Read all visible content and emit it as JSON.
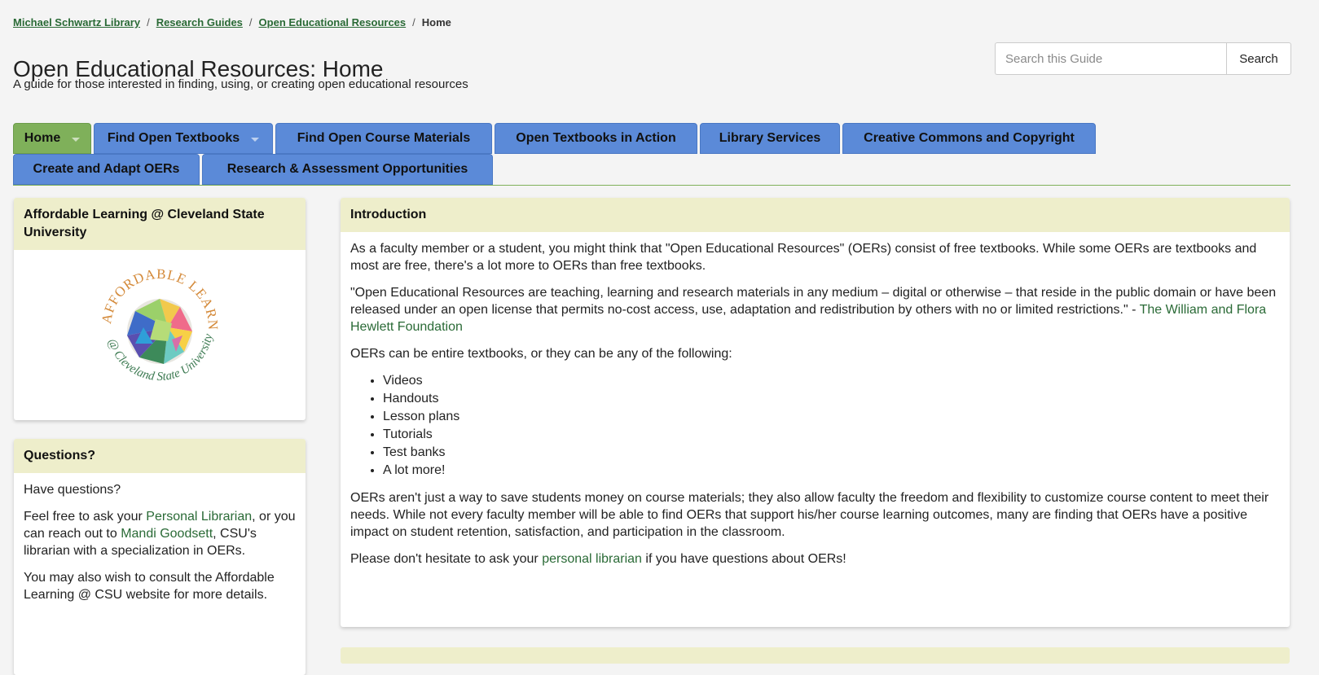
{
  "breadcrumb": {
    "items": [
      "Michael Schwartz Library",
      "Research Guides",
      "Open Educational Resources"
    ],
    "current": "Home",
    "separator": "/"
  },
  "header": {
    "title": "Open Educational Resources: Home",
    "subtitle": "A guide for those interested in finding, using, or creating open educational resources"
  },
  "search": {
    "placeholder": "Search this Guide",
    "button_label": "Search"
  },
  "tabs": {
    "row1": [
      {
        "label": "Home",
        "active": true,
        "dropdown": true
      },
      {
        "label": "Find Open Textbooks",
        "active": false,
        "dropdown": true
      },
      {
        "label": "Find Open Course Materials",
        "active": false,
        "dropdown": false
      },
      {
        "label": "Open Textbooks in Action",
        "active": false,
        "dropdown": false
      },
      {
        "label": "Library Services",
        "active": false,
        "dropdown": false
      },
      {
        "label": "Creative Commons and Copyright",
        "active": false,
        "dropdown": false
      }
    ],
    "row2": [
      {
        "label": "Create and Adapt OERs",
        "active": false,
        "dropdown": false
      },
      {
        "label": "Research & Assessment Opportunities",
        "active": false,
        "dropdown": false
      }
    ]
  },
  "sidebar": {
    "affordable": {
      "title": "Affordable Learning @ Cleveland State University",
      "logo_text_top": "AFFORDABLE LEARNING",
      "logo_text_bottom": "@ Cleveland State University"
    },
    "questions": {
      "title": "Questions?",
      "p1": "Have questions?",
      "p2_a": "Feel free to ask your ",
      "p2_link1": "Personal Librarian",
      "p2_b": ", or you can reach out to ",
      "p2_link2": "Mandi Goodsett",
      "p2_c": ", CSU's librarian with a specialization in OERs.",
      "p3": "You may also wish to consult the Affordable Learning @ CSU website for more details."
    }
  },
  "intro": {
    "title": "Introduction",
    "p1": "As a faculty member or a student, you might think that \"Open Educational Resources\" (OERs) consist of free textbooks. While some OERs are textbooks and most are free, there's a lot more to OERs than free textbooks.",
    "p2_quote": "\"Open Educational Resources are teaching, learning and research materials in any medium – digital or otherwise – that reside in the public domain or have been released under an open license that permits no-cost access, use, adaptation and redistribution by others with no or limited restrictions.\" - ",
    "p2_link": "The William and Flora Hewlett Foundation",
    "p3": "OERs can be entire textbooks, or they can be any of the following:",
    "list": [
      "Videos",
      "Handouts",
      "Lesson plans",
      "Tutorials",
      "Test banks",
      "A lot more!"
    ],
    "p4": "OERs aren't just a way to save students money on course materials; they also allow faculty the freedom and flexibility to customize course content to meet their needs. While not every faculty member will be able to find OERs that support his/her course learning outcomes, many are finding that OERs have a positive impact on student retention, satisfaction, and participation in the classroom.",
    "p5_a": "Please don't hesitate to ask your ",
    "p5_link": "personal librarian",
    "p5_b": " if you have questions about OERs!"
  },
  "colors": {
    "tab_blue": "#5b8ad8",
    "tab_active": "#7fb05a",
    "box_header": "#eeeecb",
    "link_green": "#2a6a36"
  }
}
